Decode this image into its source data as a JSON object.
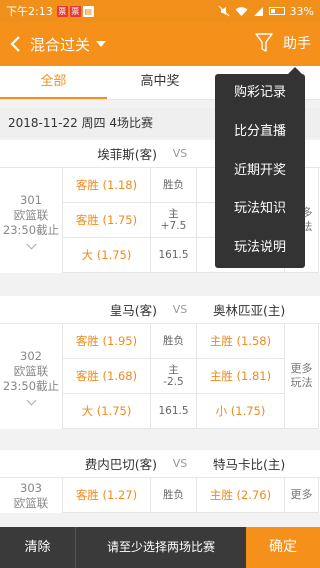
{
  "status_bar": {
    "time": "下午2:13",
    "battery": "33%"
  },
  "nav": {
    "title": "混合过关",
    "help": "助手"
  },
  "tabs": [
    {
      "label": "全部"
    },
    {
      "label": "高中奖"
    },
    {
      "label": ""
    }
  ],
  "date_row": "2018-11-22  周四  4场比赛",
  "matches": [
    {
      "home": "埃菲斯(客)",
      "vs": "VS",
      "away": "",
      "num": "301",
      "league": "欧篮联",
      "deadline": "23:50截止",
      "rows": [
        {
          "left": "客胜 (1.18)",
          "mid": "胜负",
          "right": ""
        },
        {
          "left": "客胜 (1.75)",
          "mid": "主\n+7.5",
          "right": ""
        },
        {
          "left": "大 (1.75)",
          "mid": "161.5",
          "right": ""
        }
      ],
      "more": "更多玩法"
    },
    {
      "home": "皇马(客)",
      "vs": "VS",
      "away": "奥林匹亚(主)",
      "num": "302",
      "league": "欧篮联",
      "deadline": "23:50截止",
      "rows": [
        {
          "left": "客胜 (1.95)",
          "mid": "胜负",
          "right": "主胜 (1.58)"
        },
        {
          "left": "客胜 (1.68)",
          "mid": "主\n-2.5",
          "right": "主胜 (1.81)"
        },
        {
          "left": "大 (1.75)",
          "mid": "161.5",
          "right": "小 (1.75)"
        }
      ],
      "more": "更多玩法"
    },
    {
      "home": "费内巴切(客)",
      "vs": "VS",
      "away": "特马卡比(主)",
      "num": "303",
      "league": "欧篮联",
      "deadline": "",
      "rows": [
        {
          "left": "客胜 (1.27)",
          "mid": "胜负",
          "right": "主胜 (2.76)"
        }
      ],
      "more": "更多"
    }
  ],
  "menu": [
    "购彩记录",
    "比分直播",
    "近期开奖",
    "玩法知识",
    "玩法说明"
  ],
  "bottom": {
    "clear": "清除",
    "hint": "请至少选择两场比赛",
    "confirm": "确定"
  },
  "colors": {
    "accent": "#f5901b",
    "menu_bg": "#333333",
    "bottom_bg": "#3a3a3a"
  }
}
